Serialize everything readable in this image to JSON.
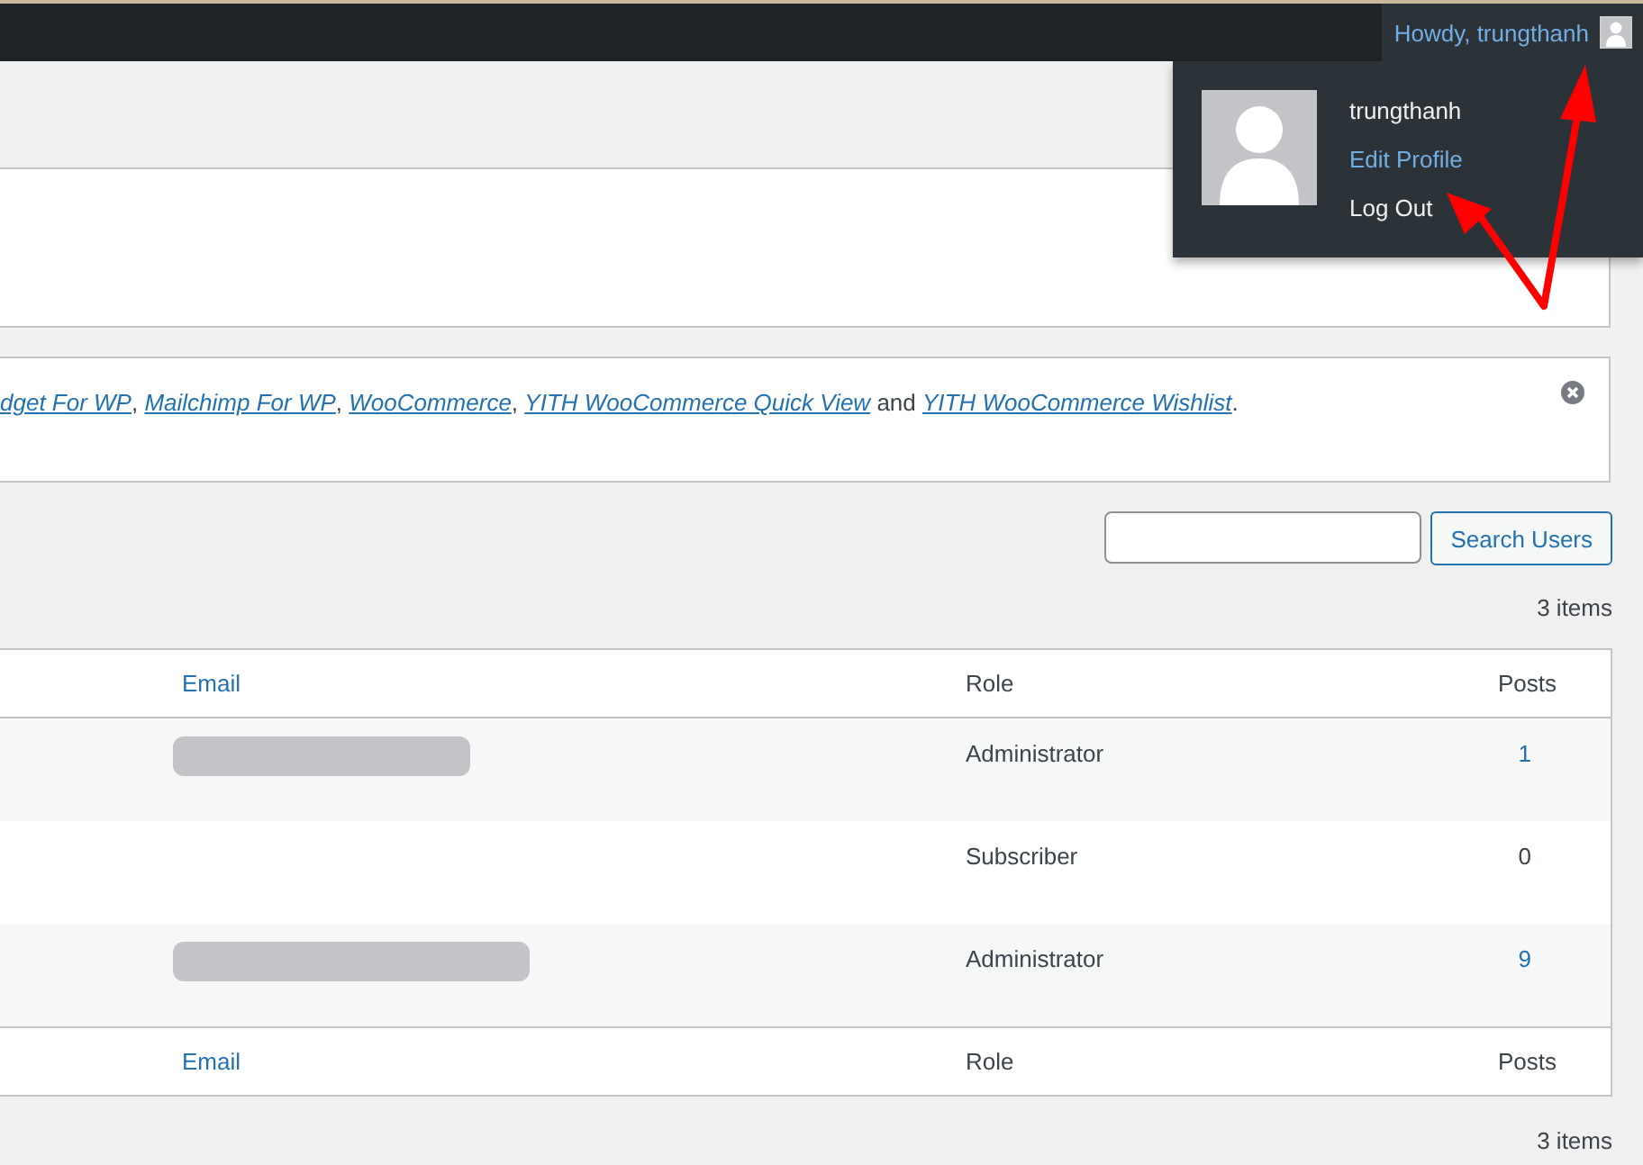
{
  "admin_bar": {
    "greeting": "Howdy, trungthanh",
    "expanded": true
  },
  "account_menu": {
    "name": "trungthanh",
    "items": [
      {
        "label": "Edit Profile",
        "selected": true
      },
      {
        "label": "Log Out",
        "selected": false
      }
    ]
  },
  "notice": {
    "links": [
      {
        "text": "dget For WP",
        "after": ", "
      },
      {
        "text": "Mailchimp For WP",
        "after": ", "
      },
      {
        "text": "WooCommerce",
        "after": ", "
      },
      {
        "text": "YITH WooCommerce Quick View",
        "after": " and "
      },
      {
        "text": "YITH WooCommerce Wishlist",
        "after": "."
      }
    ],
    "dismissible": true
  },
  "search": {
    "button": "Search Users"
  },
  "item_count_top": "3 items",
  "table": {
    "columns": [
      "Email",
      "Role",
      "Posts"
    ],
    "rows": [
      {
        "email_redacted": true,
        "role": "Administrator",
        "posts": "1",
        "posts_linked": true
      },
      {
        "email_redacted": false,
        "role": "Subscriber",
        "posts": "0",
        "posts_linked": false
      },
      {
        "email_redacted": true,
        "role": "Administrator",
        "posts": "9",
        "posts_linked": true
      }
    ],
    "footer_columns": [
      "Email",
      "Role",
      "Posts"
    ]
  },
  "item_count_bottom": "3 items"
}
